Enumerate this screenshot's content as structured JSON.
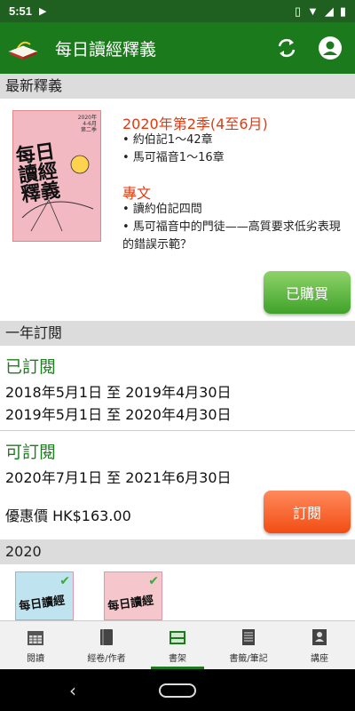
{
  "status_bar": {
    "time": "5:51"
  },
  "app_bar": {
    "title": "每日讀經釋義",
    "icons": [
      "refresh-icon",
      "account-icon"
    ]
  },
  "latest": {
    "header": "最新釋義",
    "cover": {
      "title_line1": "每日",
      "title_line2": "讀經",
      "title_line3": "釋義",
      "top_note": "2020年\n4-6月\n第二季"
    },
    "season_title": "2020年第2季(4至6月)",
    "bullets": [
      "• 約伯記1～42章",
      "• 馬可福音1～16章"
    ],
    "special_title": "專文",
    "special_bullets": [
      "• 讀約伯記四問",
      "• 馬可福音中的門徒——高質要求低劣表現的錯誤示範？"
    ],
    "owned_button": "已購買"
  },
  "subscription": {
    "header": "一年訂閱",
    "subscribed_title": "已訂閱",
    "subscribed_periods": [
      "2018年5月1日 至 2019年4月30日",
      "2019年5月1日 至 2020年4月30日"
    ],
    "available_title": "可訂閱",
    "available_period": "2020年7月1日 至 2021年6月30日",
    "price": "優惠價 HK$163.00",
    "subscribe_button": "訂閱"
  },
  "year_section": {
    "header": "2020",
    "thumbs": [
      {
        "title": "每日讀經",
        "checked": true
      },
      {
        "title": "每日讀經",
        "checked": true
      }
    ]
  },
  "bottom_nav": {
    "items": [
      {
        "label": "閱讀",
        "icon": "calendar-icon",
        "active": false
      },
      {
        "label": "經卷/作者",
        "icon": "book-icon",
        "active": false
      },
      {
        "label": "書架",
        "icon": "bookshelf-icon",
        "active": true
      },
      {
        "label": "書籤/筆記",
        "icon": "notebook-icon",
        "active": false
      },
      {
        "label": "講座",
        "icon": "lecture-icon",
        "active": false
      }
    ]
  },
  "colors": {
    "app_bar": "#1b7a1b",
    "accent_red": "#e03a10",
    "green_text": "#1e7d1e",
    "owned_button": "#4caf2f",
    "subscribe_button": "#f24d14"
  }
}
